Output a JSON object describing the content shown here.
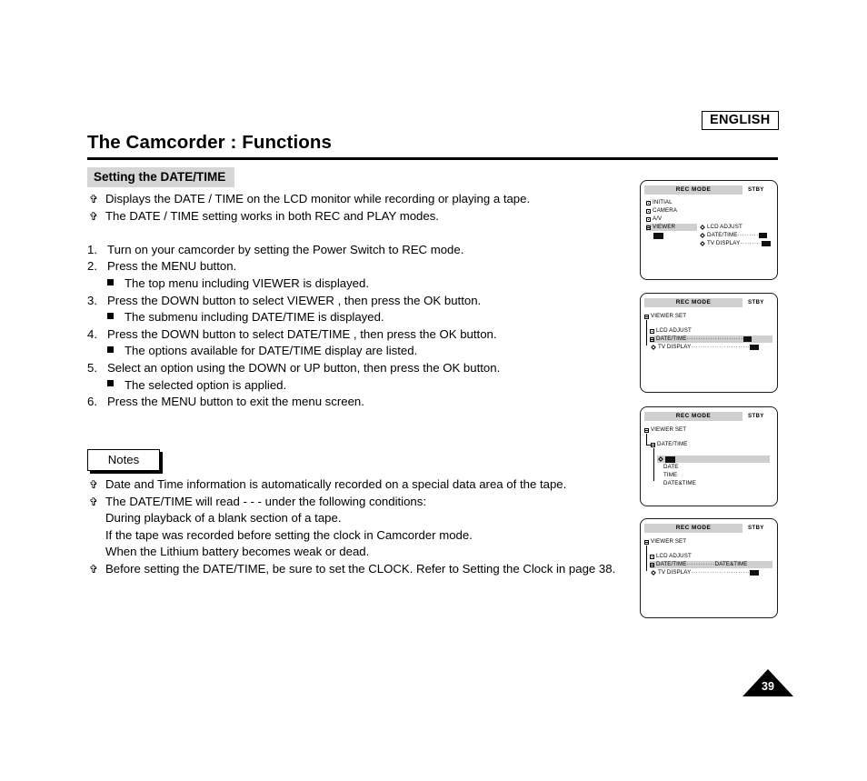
{
  "header": {
    "language_badge": "ENGLISH",
    "page_title": "The Camcorder : Functions",
    "section_heading": "Setting the DATE/TIME"
  },
  "page_number": "39",
  "intro_bullets": [
    "Displays the DATE / TIME on the LCD monitor while recording or playing a tape.",
    "The DATE / TIME setting works in both REC and PLAY modes."
  ],
  "steps": [
    {
      "num": "1.",
      "text": "Turn on your camcorder by setting the Power Switch to REC mode.",
      "sub": []
    },
    {
      "num": "2.",
      "text": "Press the MENU button.",
      "sub": [
        "The top menu including  VIEWER  is displayed."
      ]
    },
    {
      "num": "3.",
      "text": "Press the DOWN button to select  VIEWER , then press the OK button.",
      "sub": [
        "The submenu including  DATE/TIME  is displayed."
      ]
    },
    {
      "num": "4.",
      "text": "Press the DOWN button to select  DATE/TIME , then press the OK button.",
      "sub": [
        "The options available for DATE/TIME display are listed."
      ]
    },
    {
      "num": "5.",
      "text": "Select an option using the DOWN or UP button, then press the OK button.",
      "sub": [
        "The selected option is applied."
      ]
    },
    {
      "num": "6.",
      "text": "Press the MENU button to exit the menu screen.",
      "sub": []
    }
  ],
  "notes": {
    "label": "Notes",
    "items": [
      {
        "bullet": true,
        "text": "Date and Time information is automatically recorded on a special data area of the tape."
      },
      {
        "bullet": true,
        "text": "The DATE/TIME will read  - - -  under the following conditions:"
      },
      {
        "bullet": false,
        "text": "During playback of a blank section of a tape."
      },
      {
        "bullet": false,
        "text": "If the tape was recorded before setting the clock in Camcorder mode."
      },
      {
        "bullet": false,
        "text": "When the Lithium battery becomes weak or dead."
      },
      {
        "bullet": true,
        "text": "Before setting the DATE/TIME, be sure to set the CLOCK. Refer to Setting the Clock in page 38."
      }
    ]
  },
  "lcd_panels": [
    {
      "title": "REC MODE",
      "status": "STBY",
      "left_menu": [
        {
          "label": "INITIAL",
          "selected": false
        },
        {
          "label": "CAMERA",
          "selected": false
        },
        {
          "label": "A/V",
          "selected": false
        },
        {
          "label": "VIEWER",
          "selected": true
        }
      ],
      "right_menu": [
        {
          "label": "LCD ADJUST",
          "dots": "",
          "value": ""
        },
        {
          "label": "DATE/TIME",
          "dots": "·········",
          "value": "off-icon"
        },
        {
          "label": "TV DISPLAY",
          "dots": "·········",
          "value": "on-icon"
        }
      ]
    },
    {
      "title": "REC MODE",
      "status": "STBY",
      "root": "VIEWER SET",
      "items": [
        {
          "label": "LCD ADJUST",
          "icon": "folder",
          "selected": false,
          "dots": "",
          "value": ""
        },
        {
          "label": "DATE/TIME",
          "icon": "folder",
          "selected": true,
          "dots": "························",
          "value": "off-icon"
        },
        {
          "label": "TV DISPLAY",
          "icon": "diamond",
          "selected": false,
          "dots": "·························",
          "value": "on-icon"
        }
      ]
    },
    {
      "title": "REC MODE",
      "status": "STBY",
      "root": "VIEWER SET",
      "branch": "DATE/TIME",
      "options": [
        {
          "label": "",
          "badge": true,
          "selected": true
        },
        {
          "label": "DATE",
          "badge": false,
          "selected": false
        },
        {
          "label": "TIME",
          "badge": false,
          "selected": false
        },
        {
          "label": "DATE&TIME",
          "badge": false,
          "selected": false
        }
      ]
    },
    {
      "title": "REC MODE",
      "status": "STBY",
      "root": "VIEWER SET",
      "items": [
        {
          "label": "LCD ADJUST",
          "icon": "folder",
          "selected": false,
          "dots": "",
          "value": ""
        },
        {
          "label": "DATE/TIME",
          "icon": "folder",
          "selected": true,
          "dots": "············",
          "value": "DATE&TIME"
        },
        {
          "label": "TV DISPLAY",
          "icon": "diamond",
          "selected": false,
          "dots": "·························",
          "value": "on-icon"
        }
      ]
    }
  ],
  "colors": {
    "highlight": "#cfcfcf",
    "heading_bg": "#d6d6d6",
    "text": "#000000"
  }
}
